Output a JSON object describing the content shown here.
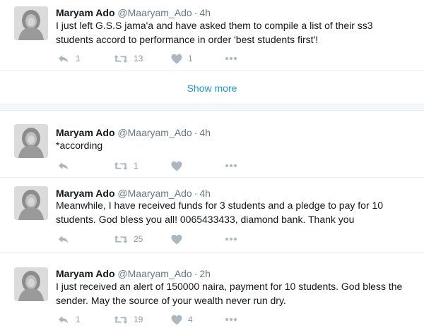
{
  "tweets": [
    {
      "name": "Maryam Ado",
      "handle": "@Maaryam_Ado",
      "time": "4h",
      "text": "I just left G.S.S  jama'a and have asked them to compile a list of their ss3 students accord to performance in order 'best students first'!",
      "reply_count": "1",
      "retweet_count": "13",
      "like_count": "1"
    },
    {
      "name": "Maryam Ado",
      "handle": "@Maaryam_Ado",
      "time": "4h",
      "text": "*according",
      "reply_count": "",
      "retweet_count": "1",
      "like_count": ""
    },
    {
      "name": "Maryam Ado",
      "handle": "@Maaryam_Ado",
      "time": "4h",
      "text": "Meanwhile, I have received funds for 3 students and a pledge to pay for 10 students. God bless you all! 0065433433, diamond bank. Thank you",
      "reply_count": "",
      "retweet_count": "25",
      "like_count": ""
    },
    {
      "name": "Maryam Ado",
      "handle": "@Maaryam_Ado",
      "time": "2h",
      "text": "I just received an alert of 150000 naira, payment for 10 students. God bless the sender. May the source of your wealth never run dry.",
      "reply_count": "1",
      "retweet_count": "19",
      "like_count": "4"
    }
  ],
  "show_more_label": "Show more",
  "separator": "·",
  "icons": {
    "reply": "reply-icon",
    "retweet": "retweet-icon",
    "like": "heart-icon",
    "more": "more-icon"
  },
  "colors": {
    "link": "#1b95e0",
    "muted": "#657786",
    "icon": "#aab8c2",
    "gap": "#f5f8fa"
  }
}
